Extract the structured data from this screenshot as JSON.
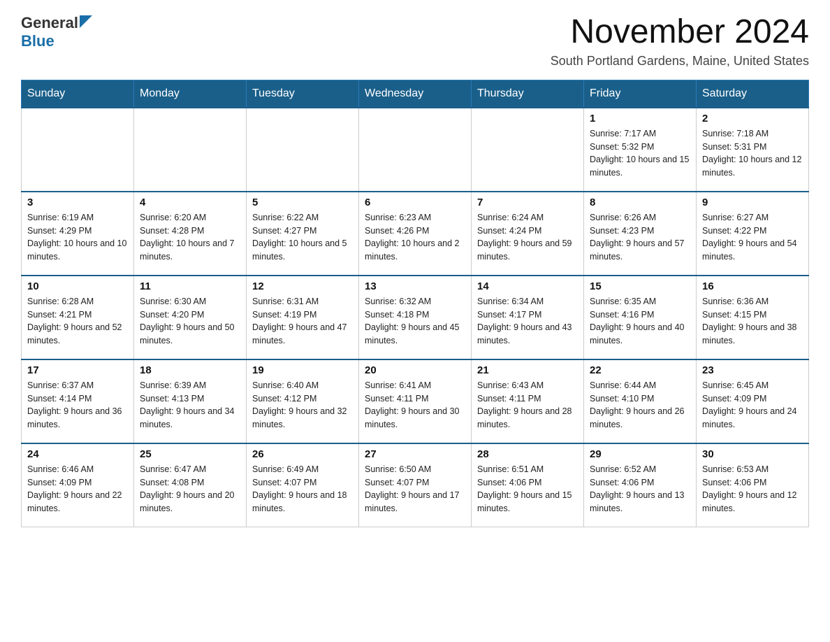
{
  "header": {
    "logo_general": "General",
    "logo_blue": "Blue",
    "month_title": "November 2024",
    "location": "South Portland Gardens, Maine, United States"
  },
  "days_of_week": [
    "Sunday",
    "Monday",
    "Tuesday",
    "Wednesday",
    "Thursday",
    "Friday",
    "Saturday"
  ],
  "weeks": [
    [
      {
        "day": "",
        "info": ""
      },
      {
        "day": "",
        "info": ""
      },
      {
        "day": "",
        "info": ""
      },
      {
        "day": "",
        "info": ""
      },
      {
        "day": "",
        "info": ""
      },
      {
        "day": "1",
        "info": "Sunrise: 7:17 AM\nSunset: 5:32 PM\nDaylight: 10 hours and 15 minutes."
      },
      {
        "day": "2",
        "info": "Sunrise: 7:18 AM\nSunset: 5:31 PM\nDaylight: 10 hours and 12 minutes."
      }
    ],
    [
      {
        "day": "3",
        "info": "Sunrise: 6:19 AM\nSunset: 4:29 PM\nDaylight: 10 hours and 10 minutes."
      },
      {
        "day": "4",
        "info": "Sunrise: 6:20 AM\nSunset: 4:28 PM\nDaylight: 10 hours and 7 minutes."
      },
      {
        "day": "5",
        "info": "Sunrise: 6:22 AM\nSunset: 4:27 PM\nDaylight: 10 hours and 5 minutes."
      },
      {
        "day": "6",
        "info": "Sunrise: 6:23 AM\nSunset: 4:26 PM\nDaylight: 10 hours and 2 minutes."
      },
      {
        "day": "7",
        "info": "Sunrise: 6:24 AM\nSunset: 4:24 PM\nDaylight: 9 hours and 59 minutes."
      },
      {
        "day": "8",
        "info": "Sunrise: 6:26 AM\nSunset: 4:23 PM\nDaylight: 9 hours and 57 minutes."
      },
      {
        "day": "9",
        "info": "Sunrise: 6:27 AM\nSunset: 4:22 PM\nDaylight: 9 hours and 54 minutes."
      }
    ],
    [
      {
        "day": "10",
        "info": "Sunrise: 6:28 AM\nSunset: 4:21 PM\nDaylight: 9 hours and 52 minutes."
      },
      {
        "day": "11",
        "info": "Sunrise: 6:30 AM\nSunset: 4:20 PM\nDaylight: 9 hours and 50 minutes."
      },
      {
        "day": "12",
        "info": "Sunrise: 6:31 AM\nSunset: 4:19 PM\nDaylight: 9 hours and 47 minutes."
      },
      {
        "day": "13",
        "info": "Sunrise: 6:32 AM\nSunset: 4:18 PM\nDaylight: 9 hours and 45 minutes."
      },
      {
        "day": "14",
        "info": "Sunrise: 6:34 AM\nSunset: 4:17 PM\nDaylight: 9 hours and 43 minutes."
      },
      {
        "day": "15",
        "info": "Sunrise: 6:35 AM\nSunset: 4:16 PM\nDaylight: 9 hours and 40 minutes."
      },
      {
        "day": "16",
        "info": "Sunrise: 6:36 AM\nSunset: 4:15 PM\nDaylight: 9 hours and 38 minutes."
      }
    ],
    [
      {
        "day": "17",
        "info": "Sunrise: 6:37 AM\nSunset: 4:14 PM\nDaylight: 9 hours and 36 minutes."
      },
      {
        "day": "18",
        "info": "Sunrise: 6:39 AM\nSunset: 4:13 PM\nDaylight: 9 hours and 34 minutes."
      },
      {
        "day": "19",
        "info": "Sunrise: 6:40 AM\nSunset: 4:12 PM\nDaylight: 9 hours and 32 minutes."
      },
      {
        "day": "20",
        "info": "Sunrise: 6:41 AM\nSunset: 4:11 PM\nDaylight: 9 hours and 30 minutes."
      },
      {
        "day": "21",
        "info": "Sunrise: 6:43 AM\nSunset: 4:11 PM\nDaylight: 9 hours and 28 minutes."
      },
      {
        "day": "22",
        "info": "Sunrise: 6:44 AM\nSunset: 4:10 PM\nDaylight: 9 hours and 26 minutes."
      },
      {
        "day": "23",
        "info": "Sunrise: 6:45 AM\nSunset: 4:09 PM\nDaylight: 9 hours and 24 minutes."
      }
    ],
    [
      {
        "day": "24",
        "info": "Sunrise: 6:46 AM\nSunset: 4:09 PM\nDaylight: 9 hours and 22 minutes."
      },
      {
        "day": "25",
        "info": "Sunrise: 6:47 AM\nSunset: 4:08 PM\nDaylight: 9 hours and 20 minutes."
      },
      {
        "day": "26",
        "info": "Sunrise: 6:49 AM\nSunset: 4:07 PM\nDaylight: 9 hours and 18 minutes."
      },
      {
        "day": "27",
        "info": "Sunrise: 6:50 AM\nSunset: 4:07 PM\nDaylight: 9 hours and 17 minutes."
      },
      {
        "day": "28",
        "info": "Sunrise: 6:51 AM\nSunset: 4:06 PM\nDaylight: 9 hours and 15 minutes."
      },
      {
        "day": "29",
        "info": "Sunrise: 6:52 AM\nSunset: 4:06 PM\nDaylight: 9 hours and 13 minutes."
      },
      {
        "day": "30",
        "info": "Sunrise: 6:53 AM\nSunset: 4:06 PM\nDaylight: 9 hours and 12 minutes."
      }
    ]
  ]
}
